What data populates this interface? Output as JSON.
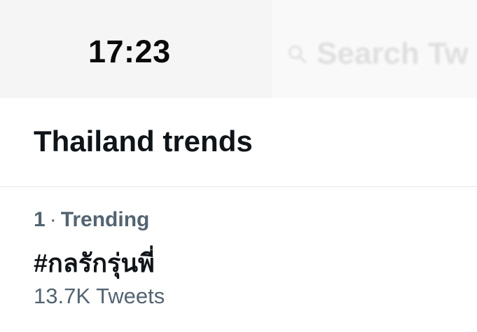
{
  "status_bar": {
    "time": "17:23",
    "search_placeholder": "Search Tw"
  },
  "header": {
    "title": "Thailand trends"
  },
  "trends": [
    {
      "rank": "1",
      "separator": "·",
      "category": "Trending",
      "name": "#กลรักรุ่นพี่",
      "tweet_count": "13.7K Tweets"
    }
  ],
  "colors": {
    "text_primary": "#0f1419",
    "text_secondary": "#536471",
    "divider": "#e4e6e8"
  }
}
